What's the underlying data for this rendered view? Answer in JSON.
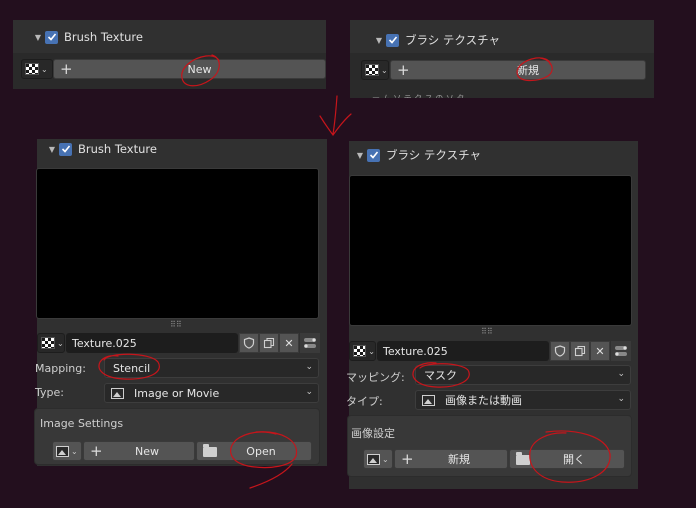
{
  "colors": {
    "background": "#230f1e",
    "panel": "#303030",
    "checkbox": "#4772b3",
    "annotation": "#c6151b"
  },
  "top_left": {
    "header": "Brush Texture",
    "new_label": "New"
  },
  "top_right": {
    "header": "ブラシ テクスチャ",
    "new_label": "新規",
    "cut_text": "ー ム ソ テ ク ス の ソ タ"
  },
  "bottom_left": {
    "header": "Brush Texture",
    "texture_name": "Texture.025",
    "mapping_label": "Mapping:",
    "mapping_value": "Stencil",
    "type_label": "Type:",
    "type_value": "Image or Movie",
    "image_settings": "Image Settings",
    "new_label": "New",
    "open_label": "Open"
  },
  "bottom_right": {
    "header": "ブラシ テクスチャ",
    "texture_name": "Texture.025",
    "mapping_label": "マッピング:",
    "mapping_value": "マスク",
    "type_label": "タイプ:",
    "type_value": "画像または動画",
    "image_settings": "画像設定",
    "new_label": "新規",
    "open_label": "開く"
  },
  "icons": {
    "expand": "triangle-down-icon",
    "checkbox": "checkbox-checked-icon",
    "texture": "checker-texture-icon",
    "add": "plus-icon",
    "shield": "fake-user-shield-icon",
    "copy": "duplicate-icon",
    "unlink": "close-icon",
    "toggle": "toggle-icon",
    "image": "image-icon",
    "folder": "folder-icon"
  }
}
